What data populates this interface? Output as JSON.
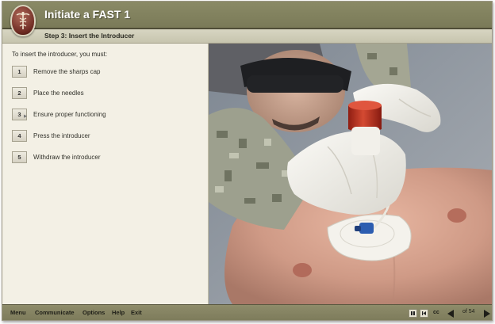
{
  "header": {
    "title": "Initiate a FAST 1",
    "step_title": "Step 3: Insert the Introducer"
  },
  "content": {
    "instruction": "To insert the introducer, you must:",
    "steps": [
      {
        "number": "1",
        "label": "Remove the sharps cap"
      },
      {
        "number": "2",
        "label": "Place the needles"
      },
      {
        "number": "3",
        "label": "Ensure proper functioning"
      },
      {
        "number": "4",
        "label": "Press the introducer"
      },
      {
        "number": "5",
        "label": "Withdraw the introducer"
      }
    ]
  },
  "footer": {
    "menu": [
      "Menu",
      "Communicate",
      "Options",
      "Help",
      "Exit"
    ],
    "cc_label": "cc",
    "page_label": "of 54"
  },
  "colors": {
    "header_bg": "#7a7a58",
    "panel_bg": "#f3f0e5",
    "footer_bg": "#8e8c6a",
    "accent_red": "#c53a26"
  }
}
